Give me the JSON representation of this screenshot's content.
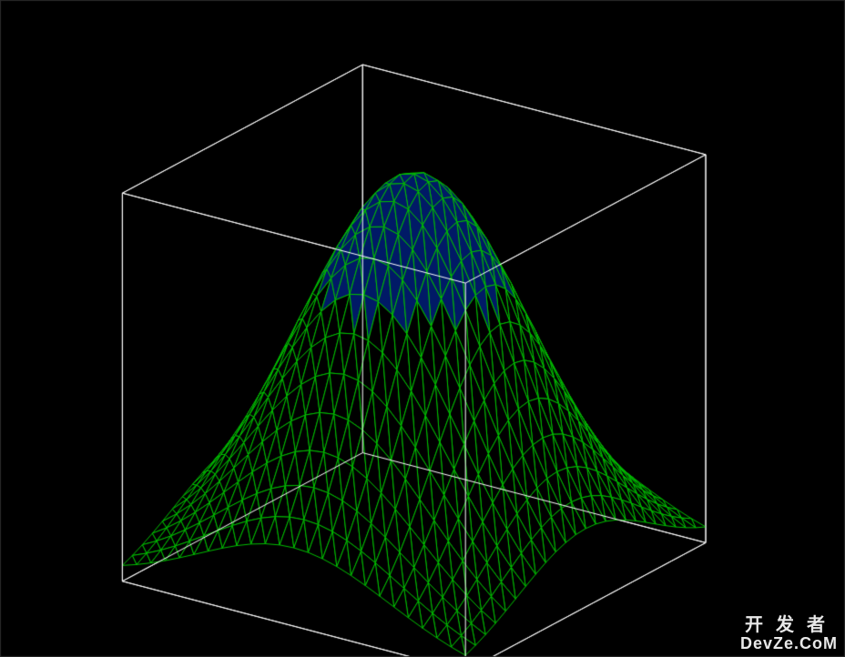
{
  "chart_data": {
    "type": "surface3d",
    "title": "",
    "description": "3D triangulated wireframe surface inside a unit cube axes box. Surface resembles a smooth radial bump (Gaussian-like) centred on the XY domain, peaking near the top of the cube and falling toward the edges.",
    "wireframe_color": "#00c000",
    "fill_color": "#001a66",
    "axes_box_color": "#ffffff",
    "background_color": "#000000",
    "x_range": [
      -1,
      1
    ],
    "y_range": [
      -1,
      1
    ],
    "z_range": [
      0,
      1
    ],
    "grid_resolution": 24,
    "surface_function": "z = exp(-1.6*(x^2 + y^2))",
    "sample_values": [
      {
        "x": -1.0,
        "y": -1.0,
        "z": 0.04
      },
      {
        "x": -1.0,
        "y": 0.0,
        "z": 0.2
      },
      {
        "x": -1.0,
        "y": 1.0,
        "z": 0.04
      },
      {
        "x": 0.0,
        "y": -1.0,
        "z": 0.2
      },
      {
        "x": 0.0,
        "y": 0.0,
        "z": 1.0
      },
      {
        "x": 0.0,
        "y": 1.0,
        "z": 0.2
      },
      {
        "x": 1.0,
        "y": -1.0,
        "z": 0.04
      },
      {
        "x": 1.0,
        "y": 0.0,
        "z": 0.2
      },
      {
        "x": 1.0,
        "y": 1.0,
        "z": 0.04
      }
    ],
    "view": {
      "azimuth_deg": -35,
      "elevation_deg": 22
    }
  },
  "watermark": {
    "line1": "开发者",
    "line2": "DevZe.CoM"
  }
}
